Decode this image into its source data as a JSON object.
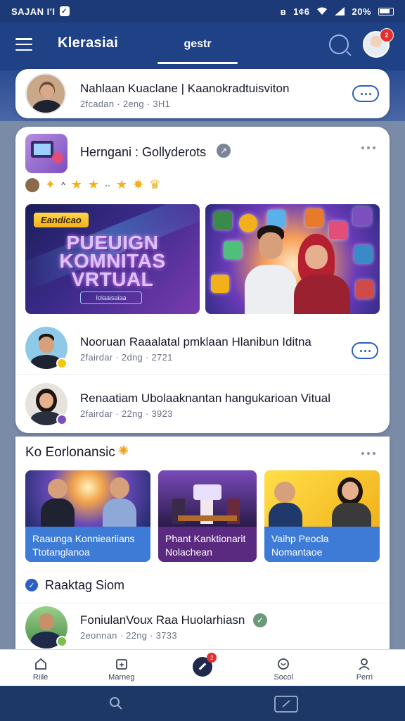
{
  "status_bar": {
    "time": "SAJAN I'I",
    "net": "1¢6",
    "battery": "20%"
  },
  "app_bar": {
    "title": "Klerasiai",
    "active_tab": "gestr",
    "notification_count": "2"
  },
  "pinned_card": {
    "name": "Nahlaan Kuaclane | Kaanokradtuisviton",
    "meta": "2fcadan · 2eng · 3H1"
  },
  "feed_card": {
    "title": "Herngani : Gollyderots",
    "hero_banner": {
      "tag": "Eandicao",
      "title_lines": [
        "PUEUIGN",
        "KOMNITAS",
        "VRTUAL"
      ],
      "subtitle": "Iolaaisaiaa"
    },
    "posts": [
      {
        "name": "Nooruan Raaalatal pmklaan Hlanibun Iditna",
        "meta": "2fairdar · 2dng · 2721"
      },
      {
        "name": "Renaatiam Ubolaaknantan hangukarioan Vitual",
        "meta": "2fairdar · 22ng · 3923"
      }
    ]
  },
  "section_one": {
    "title": "Ko Eorlonansic",
    "tiles": [
      {
        "caption_lines": [
          "Raaunga Konnieariians",
          "Ttotanglanoa"
        ],
        "color": "#3d7bd6"
      },
      {
        "caption_lines": [
          "Phant Kanktionarit",
          "Nolachean"
        ],
        "color": "#5a2a80"
      },
      {
        "caption_lines": [
          "Vaihp Peocla",
          "Nomantaoe"
        ],
        "color": "#3d7bd6"
      }
    ]
  },
  "section_two": {
    "title": "Raaktag Siom",
    "post": {
      "name": "FoniulanVoux Raa Huolarhiasn",
      "meta": "2eonnan · 22ng · 3733"
    }
  },
  "bottom_nav": [
    {
      "label": "Riile",
      "icon": "home-icon"
    },
    {
      "label": "Marneg",
      "icon": "calendar-icon"
    },
    {
      "label": "",
      "icon": "create-icon",
      "badge": "2"
    },
    {
      "label": "Socol",
      "icon": "heart-icon"
    },
    {
      "label": "Perri",
      "icon": "profile-icon"
    }
  ],
  "colors": {
    "brand": "#1f4185",
    "accent": "#2b5fc4",
    "badge": "#e0302f"
  }
}
